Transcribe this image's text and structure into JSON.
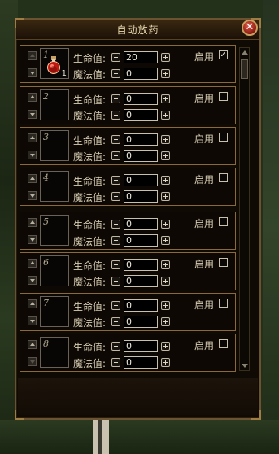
{
  "window": {
    "title": "自动放药",
    "close": "✕"
  },
  "labels": {
    "hp": "生命值:",
    "mp": "魔法值:",
    "enable": "启用"
  },
  "slots": [
    {
      "num": "1",
      "hp": "20",
      "mp": "0",
      "checked": "✓",
      "count": "1",
      "potion": "red-potion"
    },
    {
      "num": "2",
      "hp": "0",
      "mp": "0",
      "checked": ""
    },
    {
      "num": "3",
      "hp": "0",
      "mp": "0",
      "checked": ""
    },
    {
      "num": "4",
      "hp": "0",
      "mp": "0",
      "checked": ""
    },
    {
      "num": "5",
      "hp": "0",
      "mp": "0",
      "checked": ""
    },
    {
      "num": "6",
      "hp": "0",
      "mp": "0",
      "checked": ""
    },
    {
      "num": "7",
      "hp": "0",
      "mp": "0",
      "checked": ""
    },
    {
      "num": "8",
      "hp": "0",
      "mp": "0",
      "checked": ""
    }
  ]
}
